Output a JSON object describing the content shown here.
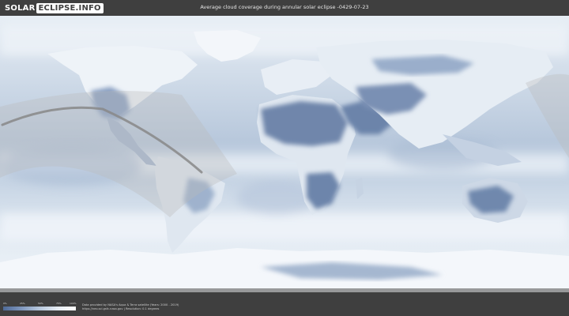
{
  "header": {
    "logo_part1": "SOLAR",
    "logo_part2": "ECLIPSE.INFO",
    "title": "Average cloud coverage during annular solar eclipse -0429-07-23"
  },
  "legend": {
    "ticks": [
      "0%",
      "25%",
      "50%",
      "75%",
      "100%"
    ],
    "colors": [
      "#4f6a97",
      "#7f97bd",
      "#b7c7dc",
      "#e6ecf3",
      "#ffffff"
    ]
  },
  "credits": {
    "line1": "Data provided by NASA's Aqua & Terra satellite (Years: 2000 - 2019)",
    "line2": "https://neo.sci.gsfc.nasa.gov | Resolution: 0.1 degrees"
  },
  "map": {
    "ocean_color": "#d6e1ec",
    "land_cloudy_color": "#eef3f8",
    "land_clear_color": "#6f86ab",
    "shadow_band_color": "#b9b9b9",
    "central_line_color": "#888888"
  }
}
